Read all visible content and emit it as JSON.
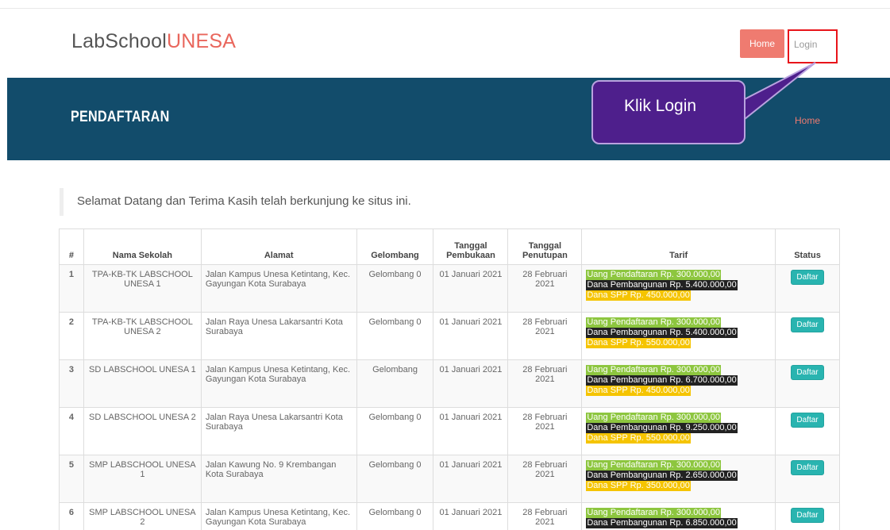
{
  "header": {
    "brand_main": "LabSchool",
    "brand_accent": "UNESA",
    "nav": {
      "home": "Home",
      "login": "Login"
    }
  },
  "banner": {
    "title": "PENDAFTARAN",
    "breadcrumb": "Home"
  },
  "callout": {
    "text": "Klik Login"
  },
  "welcome": "Selamat Datang dan Terima Kasih telah berkunjung ke situs ini.",
  "table": {
    "headers": [
      "#",
      "Nama Sekolah",
      "Alamat",
      "Gelombang",
      "Tanggal Pembukaan",
      "Tanggal Penutupan",
      "Tarif",
      "Status"
    ],
    "rows": [
      {
        "no": "1",
        "nama": "TPA-KB-TK LABSCHOOL UNESA 1",
        "alamat": "Jalan Kampus Unesa Ketintang, Kec. Gayungan Kota Surabaya",
        "gelombang": "Gelombang 0",
        "buka": "01 Januari 2021",
        "tutup": "28 Februari 2021",
        "pendaftaran": "Uang Pendaftaran Rp. 300.000,00",
        "pembangunan": "Dana Pembangunan Rp. 5.400.000,00",
        "spp": "Dana SPP Rp. 450.000,00",
        "status": "Daftar"
      },
      {
        "no": "2",
        "nama": "TPA-KB-TK LABSCHOOL UNESA 2",
        "alamat": "Jalan Raya Unesa Lakarsantri Kota Surabaya",
        "gelombang": "Gelombang 0",
        "buka": "01 Januari 2021",
        "tutup": "28 Februari 2021",
        "pendaftaran": "Uang Pendaftaran Rp. 300.000,00",
        "pembangunan": "Dana Pembangunan Rp. 5.400.000,00",
        "spp": "Dana SPP Rp. 550.000,00",
        "status": "Daftar"
      },
      {
        "no": "3",
        "nama": "SD LABSCHOOL UNESA 1",
        "alamat": "Jalan Kampus Unesa Ketintang, Kec. Gayungan Kota Surabaya",
        "gelombang": "Gelombang",
        "buka": "01 Januari 2021",
        "tutup": "28 Februari 2021",
        "pendaftaran": "Uang Pendaftaran Rp. 300.000,00",
        "pembangunan": "Dana Pembangunan Rp. 6.700.000,00",
        "spp": "Dana SPP Rp. 450.000,00",
        "status": "Daftar"
      },
      {
        "no": "4",
        "nama": "SD LABSCHOOL UNESA 2",
        "alamat": "Jalan Raya Unesa Lakarsantri Kota Surabaya",
        "gelombang": "Gelombang 0",
        "buka": "01 Januari 2021",
        "tutup": "28 Februari 2021",
        "pendaftaran": "Uang Pendaftaran Rp. 300.000,00",
        "pembangunan": "Dana Pembangunan Rp. 9.250.000,00",
        "spp": "Dana SPP Rp. 550.000,00",
        "status": "Daftar"
      },
      {
        "no": "5",
        "nama": "SMP LABSCHOOL UNESA 1",
        "alamat": "Jalan Kawung No. 9 Krembangan Kota Surabaya",
        "gelombang": "Gelombang 0",
        "buka": "01 Januari 2021",
        "tutup": "28 Februari 2021",
        "pendaftaran": "Uang Pendaftaran Rp. 300.000,00",
        "pembangunan": "Dana Pembangunan Rp. 2.650.000,00",
        "spp": "Dana SPP Rp. 350.000,00",
        "status": "Daftar"
      },
      {
        "no": "6",
        "nama": "SMP LABSCHOOL UNESA 2",
        "alamat": "Jalan Kampus Unesa Ketintang, Kec. Gayungan Kota Surabaya",
        "gelombang": "Gelombang 0",
        "buka": "01 Januari 2021",
        "tutup": "28 Februari 2021",
        "pendaftaran": "Uang Pendaftaran Rp. 300.000,00",
        "pembangunan": "Dana Pembangunan Rp. 6.850.000,00",
        "spp": "",
        "status": "Daftar"
      }
    ]
  },
  "colors": {
    "accent": "#e9665c",
    "banner": "#124c6b",
    "callout": "#4e1f8c",
    "tarif_green": "#8dc63f",
    "tarif_black": "#222222",
    "tarif_yellow": "#f5c400",
    "status_button": "#29b4b0"
  }
}
